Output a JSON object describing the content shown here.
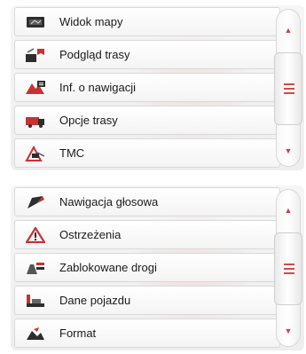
{
  "menu1": {
    "items": [
      {
        "label": "Widok mapy",
        "icon": "map-view-icon"
      },
      {
        "label": "Podgląd trasy",
        "icon": "route-preview-icon"
      },
      {
        "label": "Inf. o nawigacji",
        "icon": "navigation-info-icon"
      },
      {
        "label": "Opcje trasy",
        "icon": "route-options-icon"
      },
      {
        "label": "TMC",
        "icon": "tmc-icon"
      }
    ],
    "scroll_up": "▲",
    "scroll_down": "▼"
  },
  "menu2": {
    "items": [
      {
        "label": "Nawigacja głosowa",
        "icon": "voice-navigation-icon"
      },
      {
        "label": "Ostrzeżenia",
        "icon": "warning-icon"
      },
      {
        "label": "Zablokowane drogi",
        "icon": "blocked-roads-icon"
      },
      {
        "label": "Dane pojazdu",
        "icon": "vehicle-data-icon"
      },
      {
        "label": "Format",
        "icon": "format-icon"
      }
    ],
    "scroll_up": "▲",
    "scroll_down": "▼"
  },
  "colors": {
    "accent": "#d04040",
    "icon_dark": "#2d2d2d"
  }
}
